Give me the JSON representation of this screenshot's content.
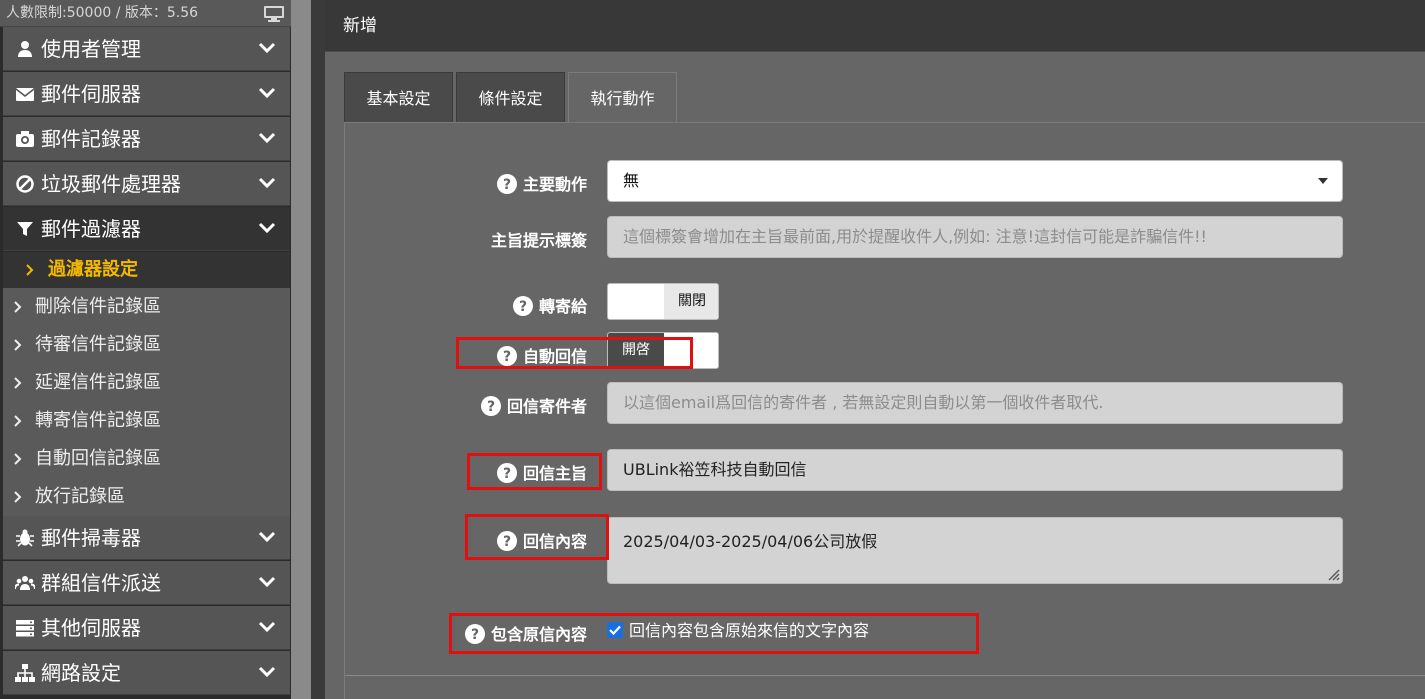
{
  "sidebar": {
    "info_text": "人數限制:50000 / 版本：5.56",
    "menu": [
      {
        "label": "使用者管理",
        "icon": "user-icon"
      },
      {
        "label": "郵件伺服器",
        "icon": "envelope-icon"
      },
      {
        "label": "郵件記錄器",
        "icon": "camera-icon"
      },
      {
        "label": "垃圾郵件處理器",
        "icon": "ban-icon"
      },
      {
        "label": "郵件過濾器",
        "icon": "filter-icon"
      }
    ],
    "submenu": [
      {
        "label": "過濾器設定"
      },
      {
        "label": "刪除信件記錄區"
      },
      {
        "label": "待審信件記錄區"
      },
      {
        "label": "延遲信件記錄區"
      },
      {
        "label": "轉寄信件記錄區"
      },
      {
        "label": "自動回信記錄區"
      },
      {
        "label": "放行記錄區"
      }
    ],
    "menu_bottom": [
      {
        "label": "郵件掃毒器",
        "icon": "bug-icon"
      },
      {
        "label": "群組信件派送",
        "icon": "users-icon"
      },
      {
        "label": "其他伺服器",
        "icon": "server-icon"
      },
      {
        "label": "網路設定",
        "icon": "sitemap-icon"
      }
    ]
  },
  "panel": {
    "title": "新增",
    "tabs": [
      {
        "label": "基本設定"
      },
      {
        "label": "條件設定"
      },
      {
        "label": "執行動作"
      }
    ]
  },
  "form": {
    "main_action": {
      "label": "主要動作",
      "value": "無"
    },
    "subject_tag": {
      "label": "主旨提示標簽",
      "placeholder": "這個標簽會增加在主旨最前面,用於提醒收件人,例如: 注意!這封信可能是詐騙信件!!"
    },
    "forward_to": {
      "label": "轉寄給",
      "toggle_text": "關閉"
    },
    "auto_reply": {
      "label": "自動回信",
      "toggle_text": "開啓"
    },
    "reply_sender": {
      "label": "回信寄件者",
      "placeholder": "以這個email爲回信的寄件者 , 若無設定則自動以第一個收件者取代."
    },
    "reply_subject": {
      "label": "回信主旨",
      "value": "UBLink裕笠科技自動回信"
    },
    "reply_content": {
      "label": "回信內容",
      "value": "2025/04/03-2025/04/06公司放假"
    },
    "include_original": {
      "label": "包含原信內容",
      "checkbox_label": "回信內容包含原始來信的文字內容",
      "checked": true
    }
  },
  "colors": {
    "highlight_box": "#e01010",
    "active_submenu": "#f5b800",
    "checkbox": "#1a6fe0"
  }
}
